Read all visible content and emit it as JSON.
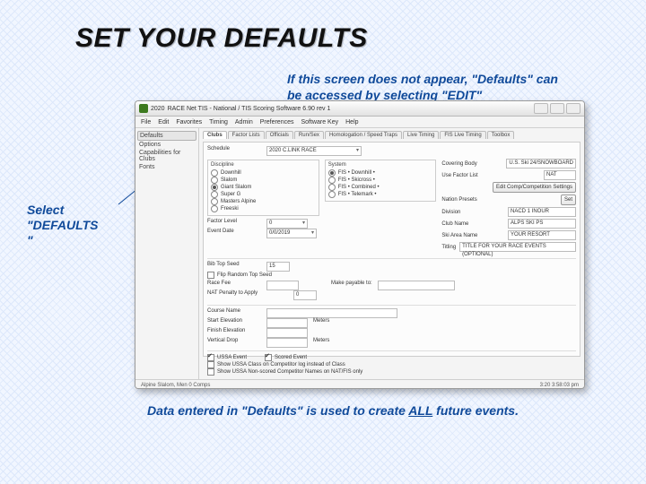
{
  "slide": {
    "title": "SET YOUR DEFAULTS",
    "top_annotation": "If this screen does not appear, \"Defaults\" can ",
    "top_annotation_b": "be accessed by selecting \"EDIT\"",
    "left_annotation_a": "Select",
    "left_annotation_b": "\"DEFAULTS",
    "left_annotation_c": "\"",
    "bottom_annotation_a": "Data entered in \"Defaults\" is used to create ",
    "bottom_annotation_all": "ALL",
    "bottom_annotation_b": " future events."
  },
  "app": {
    "year": "2020",
    "title_a": "RACE Net TIS - National / TIS Scoring Software 6.90 rev 1",
    "menubar": [
      "File",
      "Edit",
      "Favorites",
      "Timing",
      "Admin",
      "Preferences",
      "Software Key",
      "Help"
    ],
    "sidebar": {
      "items": [
        "Defaults",
        "Options",
        "Capabilities for Clubs",
        "Fonts"
      ],
      "selected_index": 0
    },
    "tabs": {
      "items": [
        "Clubs",
        "Factor Lists",
        "Officials",
        "Run/Sex",
        "Homologation / Speed Traps",
        "Live Timing",
        "FIS Live Timing",
        "Toolbox"
      ],
      "active_index": 0
    },
    "schedule_label": "Schedule",
    "schedule_value": "2020 C.LINK RACE",
    "discipline": {
      "label": "Discipline",
      "options": [
        "Downhill",
        "Slalom",
        "Giant Slalom",
        "Super G",
        "Masters Alpine",
        "Freeski"
      ],
      "selected_index": 2
    },
    "systems": {
      "label": "System",
      "options": [
        "FIS • Downhill •",
        "FIS • Skicross •",
        "FIS • Combined •",
        "FIS • Telemark •"
      ]
    },
    "factor_level_label": "Factor Level",
    "factor_level_value": "0",
    "event_date_label": "Event Date",
    "event_date_value": "0/0/2019",
    "right": {
      "covering_body_label": "Covering Body",
      "covering_body_value": "U.S. Ski 24/SNOWBOARD",
      "use_factor_label": "Use Factor List",
      "use_factor_value": "NAT",
      "edit_btn": "Edit Comp/Competition Settings",
      "nation_presets_label": "Nation Presets",
      "nation_presets_value": "Set",
      "division_label": "Division",
      "division_value": "NACD 1 INOUR",
      "club_label": "Club Name",
      "club_value": "ALPS SKI PS",
      "ski_area_label": "Ski Area Name",
      "ski_area_value": "YOUR RESORT",
      "titling_label": "Titling",
      "titling_value": "TITLE FOR YOUR RACE EVENTS (OPTIONAL)"
    },
    "numbers": {
      "bib_top_label": "Bib Top Seed",
      "bib_top_value": "15",
      "flip_label": "Flip Random Top Seed",
      "race_fee_label": "Race Fee",
      "nat_penalty_label": "NAT Penalty to Apply",
      "payable_prompt": "Make payable to:",
      "payable_value": "",
      "penalty_value": "0"
    },
    "course": {
      "course_name_label": "Course Name",
      "start_elev_label": "Start Elevation",
      "finish_elev_label": "Finish Elevation",
      "vert_drop_label": "Vertical Drop",
      "meters": "Meters"
    },
    "bottom_checks": {
      "a_label": "USSA Event",
      "b_label": "Scored Event",
      "c_label": "Show USSA Class on Competitor log instead of Class",
      "d_label": "Show USSA Non-scored Competitor Names on NAT/FIS only"
    },
    "status": {
      "left": "Alpine Slalom, Men   0 Comps",
      "right": "3:20   3:58:03 pm"
    }
  }
}
